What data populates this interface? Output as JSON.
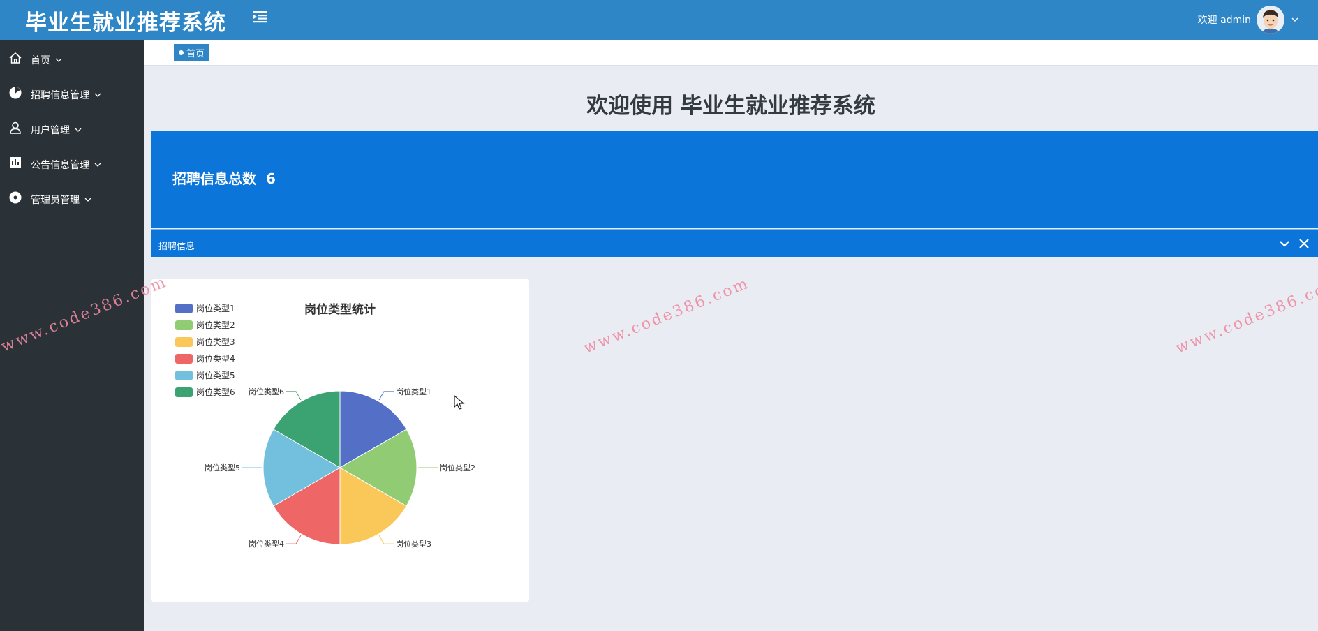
{
  "header": {
    "app_title": "毕业生就业推荐系统",
    "welcome_user": "欢迎 admin",
    "menu_toggle_icon": "menu-fold-icon",
    "avatar_icon": "user-avatar-icon"
  },
  "sidebar": {
    "items": [
      {
        "label": "首页",
        "icon": "home-icon"
      },
      {
        "label": "招聘信息管理",
        "icon": "pie-icon"
      },
      {
        "label": "用户管理",
        "icon": "user-icon"
      },
      {
        "label": "公告信息管理",
        "icon": "chart-icon"
      },
      {
        "label": "管理员管理",
        "icon": "circle-icon"
      }
    ]
  },
  "breadcrumb": {
    "tag": "首页"
  },
  "main": {
    "welcome": "欢迎使用 毕业生就业推荐系统",
    "stat_label": "招聘信息总数",
    "stat_value": "6",
    "panel_title": "招聘信息"
  },
  "watermark": "www.code386.com",
  "colors": {
    "header": "#2e86c7",
    "sidebar": "#2b3237",
    "panel": "#0b75da",
    "background": "#e9edf3"
  },
  "chart_data": {
    "type": "pie",
    "title": "岗位类型统计",
    "legend_position": "top-left",
    "categories": [
      "岗位类型1",
      "岗位类型2",
      "岗位类型3",
      "岗位类型4",
      "岗位类型5",
      "岗位类型6"
    ],
    "values": [
      1,
      1,
      1,
      1,
      1,
      1
    ],
    "colors": [
      "#5470c6",
      "#91cc75",
      "#fac858",
      "#ee6666",
      "#73c0de",
      "#3ba272"
    ]
  }
}
